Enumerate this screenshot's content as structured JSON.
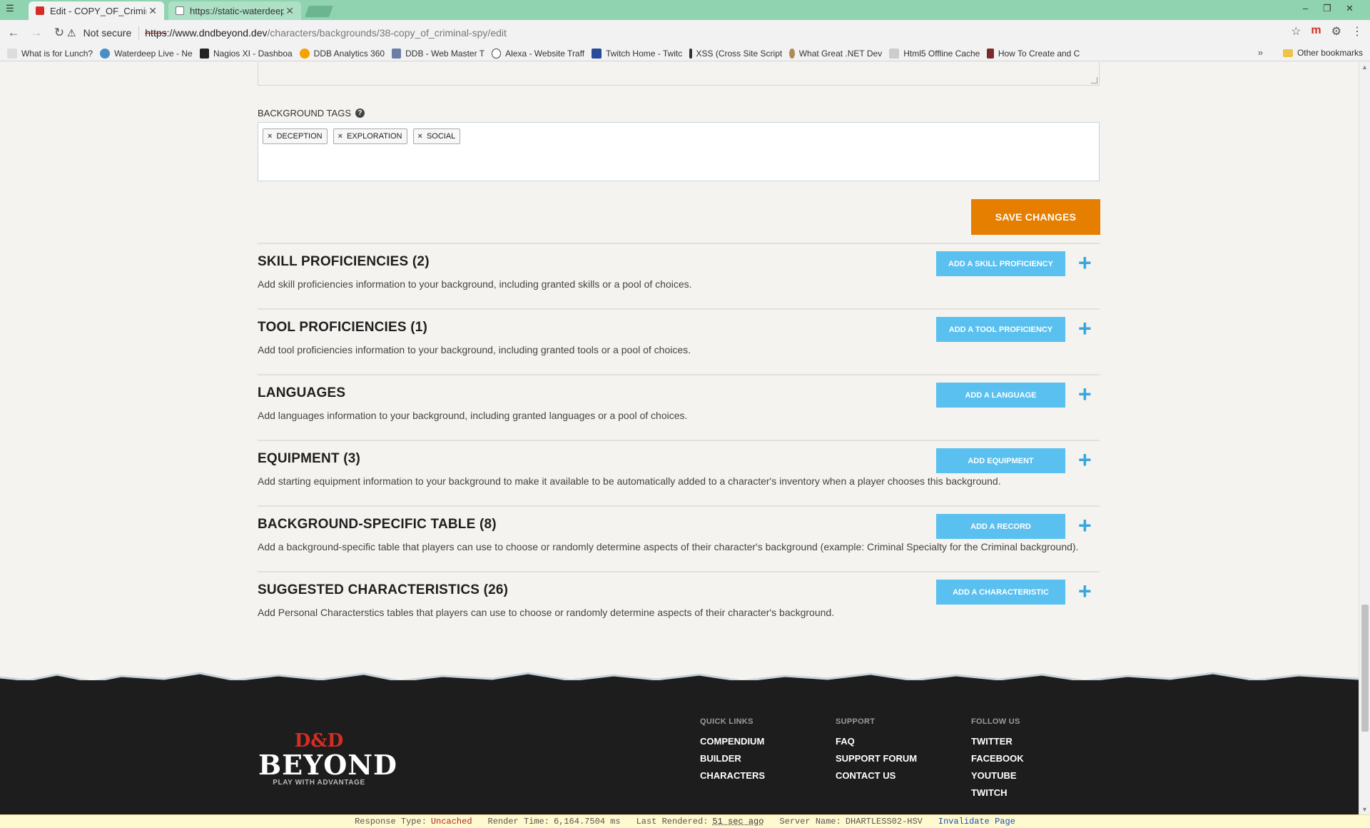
{
  "browser": {
    "tabs": [
      {
        "title": "Edit - COPY_OF_Criminal",
        "active": true
      },
      {
        "title": "https://static-waterdeep",
        "active": false
      }
    ],
    "security_label": "Not secure",
    "url_scheme": "https",
    "url_host": "://www.dndbeyond.dev",
    "url_path": "/characters/backgrounds/38-copy_of_criminal-spy/edit",
    "bookmarks": [
      "What is for Lunch?",
      "Waterdeep Live - Ne",
      "Nagios XI - Dashboa",
      "DDB Analytics 360",
      "DDB - Web Master T",
      "Alexa - Website Traff",
      "Twitch Home - Twitc",
      "XSS (Cross Site Script",
      "What Great .NET Dev",
      "Html5 Offline Cache",
      "How To Create and C"
    ],
    "bookmarks_more": "»",
    "other_bookmarks": "Other bookmarks"
  },
  "form": {
    "tags_label": "BACKGROUND TAGS",
    "tags": [
      "DECEPTION",
      "EXPLORATION",
      "SOCIAL"
    ],
    "save_label": "SAVE CHANGES"
  },
  "sections": [
    {
      "title": "SKILL PROFICIENCIES (2)",
      "description": "Add skill proficiencies information to your background, including granted skills or a pool of choices.",
      "button": "ADD A SKILL PROFICIENCY"
    },
    {
      "title": "TOOL PROFICIENCIES (1)",
      "description": "Add tool proficiencies information to your background, including granted tools or a pool of choices.",
      "button": "ADD A TOOL PROFICIENCY"
    },
    {
      "title": "LANGUAGES",
      "description": "Add languages information to your background, including granted languages or a pool of choices.",
      "button": "ADD A LANGUAGE"
    },
    {
      "title": "EQUIPMENT (3)",
      "description": "Add starting equipment information to your background to make it available to be automatically added to a character's inventory when a player chooses this background.",
      "button": "ADD EQUIPMENT"
    },
    {
      "title": "BACKGROUND-SPECIFIC TABLE (8)",
      "description": "Add a background-specific table that players can use to choose or randomly determine aspects of their character's background (example: Criminal Specialty for the Criminal background).",
      "button": "ADD A RECORD"
    },
    {
      "title": "SUGGESTED CHARACTERISTICS (26)",
      "description": "Add Personal Characterstics tables that players can use to choose or randomly determine aspects of their character's background.",
      "button": "ADD A CHARACTERISTIC"
    }
  ],
  "footer": {
    "logo_dd": "D&D",
    "logo_beyond": "BEYOND",
    "logo_tagline": "PLAY WITH ADVANTAGE",
    "columns": [
      {
        "heading": "QUICK LINKS",
        "links": [
          "COMPENDIUM",
          "BUILDER",
          "CHARACTERS"
        ]
      },
      {
        "heading": "SUPPORT",
        "links": [
          "FAQ",
          "SUPPORT FORUM",
          "CONTACT US"
        ]
      },
      {
        "heading": "FOLLOW US",
        "links": [
          "TWITTER",
          "FACEBOOK",
          "YOUTUBE",
          "TWITCH"
        ]
      }
    ]
  },
  "devbar": {
    "response_type_label": "Response Type:",
    "response_type": "Uncached",
    "render_time_label": "Render Time:",
    "render_time": "6,164.7504 ms",
    "last_rendered_label": "Last Rendered:",
    "last_rendered": "51 sec ago",
    "server_name_label": "Server Name:",
    "server_name": "DHARTLESS02-HSV",
    "invalidate_label": "Invalidate Page"
  },
  "colors": {
    "save_button": "#e67e00",
    "add_button": "#5ac0ef",
    "plus_icon": "#36a7e0",
    "footer_bg": "#1d1d1d",
    "logo_red": "#d42d23"
  }
}
